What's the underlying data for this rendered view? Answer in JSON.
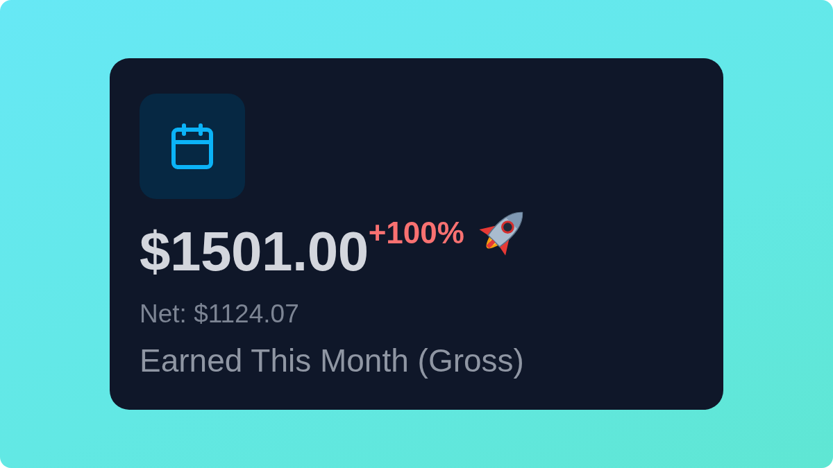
{
  "card": {
    "amount": "$1501.00",
    "change": "+100%",
    "net": "Net: $1124.07",
    "label": "Earned This Month (Gross)"
  }
}
